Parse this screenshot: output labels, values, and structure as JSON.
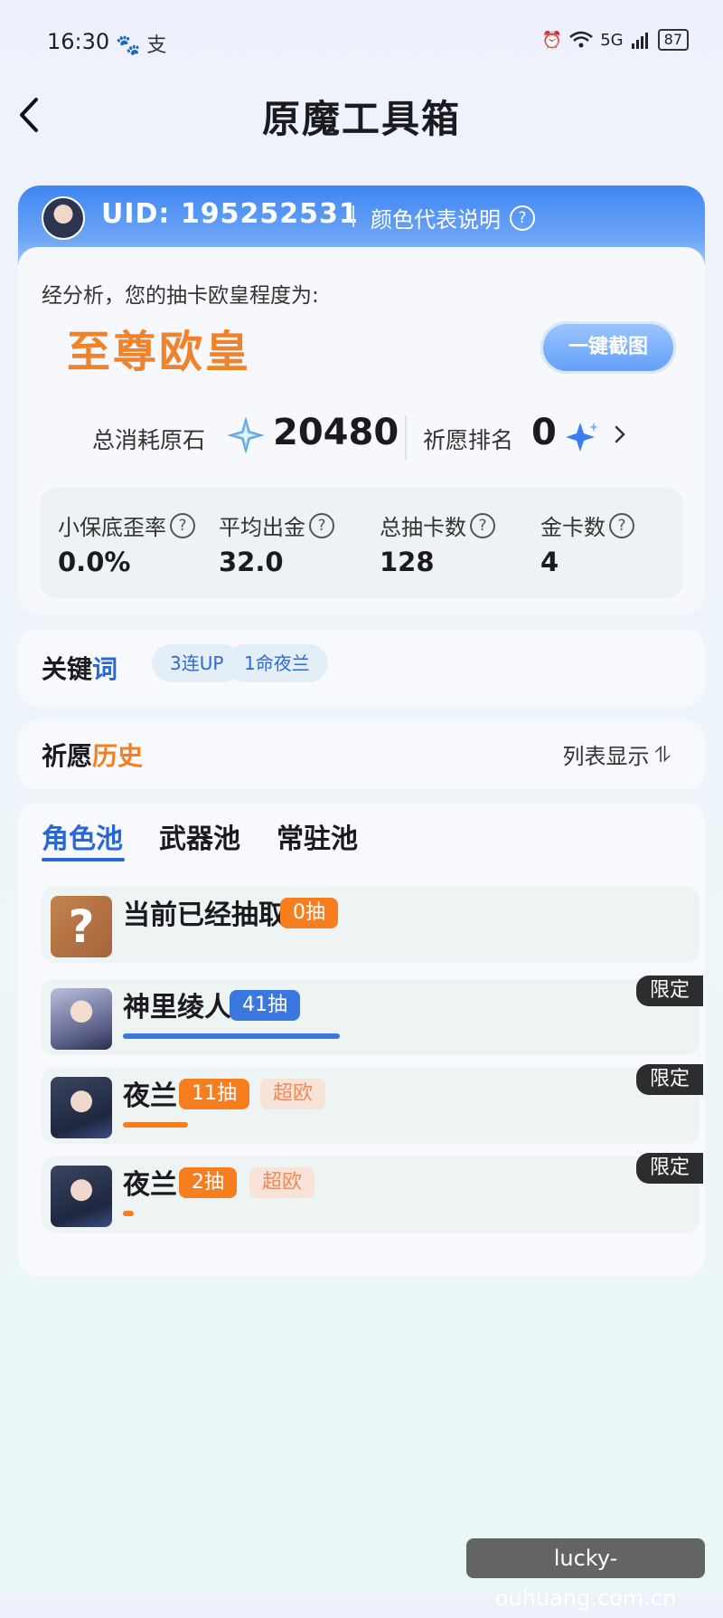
{
  "status_bar": {
    "time": "16:30",
    "app_icons": "🐾 支",
    "network": "5G",
    "battery": "87"
  },
  "header": {
    "title": "原魔工具箱"
  },
  "uid_card": {
    "uid_text": "UID: 195252531",
    "color_legend": "颜色代表说明"
  },
  "summary": {
    "analysis_text": "经分析，您的抽卡欧皇程度为:",
    "rank_title": "至尊欧皇",
    "screenshot_button": "一键截图",
    "consume_label": "总消耗原石",
    "consume_value": "20480",
    "wish_rank_label": "祈愿排名",
    "wish_rank_value": "0"
  },
  "stats": [
    {
      "label": "小保底歪率",
      "value": "0.0%"
    },
    {
      "label": "平均出金",
      "value": "32.0"
    },
    {
      "label": "总抽卡数",
      "value": "128"
    },
    {
      "label": "金卡数",
      "value": "4"
    }
  ],
  "keywords": {
    "title_a": "关键",
    "title_b": "词",
    "chips": [
      "3连UP",
      "1命夜兰"
    ]
  },
  "history": {
    "title_a": "祈愿",
    "title_b": "历史",
    "display_mode": "列表显示",
    "sort_icon": "⥮"
  },
  "pools": {
    "tabs": [
      "角色池",
      "武器池",
      "常驻池"
    ],
    "active_tab": 0,
    "rows": [
      {
        "name": "当前已经抽取",
        "pulls": "0抽",
        "pill_color": "orange",
        "tag": "",
        "limited": "",
        "avatar": "?",
        "progress": 0
      },
      {
        "name": "神里绫人",
        "pulls": "41抽",
        "pill_color": "blue",
        "tag": "",
        "limited": "限定",
        "avatar": "ayato",
        "progress": 0.53
      },
      {
        "name": "夜兰",
        "pulls": "11抽",
        "pill_color": "orange",
        "tag": "超欧",
        "limited": "限定",
        "avatar": "yelan",
        "progress": 0.14
      },
      {
        "name": "夜兰",
        "pulls": "2抽",
        "pill_color": "orange",
        "tag": "超欧",
        "limited": "限定",
        "avatar": "yelan",
        "progress": 0.025
      }
    ]
  },
  "colors": {
    "accent_blue": "#2a67d6",
    "accent_orange": "#f77e1f",
    "rank_orange": "#f0822a"
  },
  "watermark": "lucky-ouhuang.com.cn"
}
